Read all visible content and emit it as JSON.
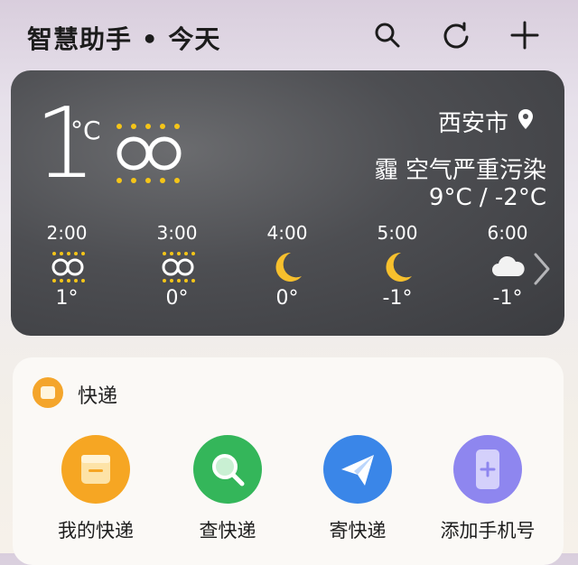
{
  "header": {
    "title": "智慧助手 • 今天",
    "icons": [
      "search-icon",
      "refresh-icon",
      "add-icon"
    ]
  },
  "weather": {
    "current_temp": "1",
    "unit": "°C",
    "condition_icon": "fog-icon",
    "city": "西安市",
    "air_quality": "霾 空气严重污染",
    "range": "9°C / -2°C",
    "hourly": [
      {
        "time": "2:00",
        "icon": "fog-icon",
        "temp": "1°"
      },
      {
        "time": "3:00",
        "icon": "fog-icon",
        "temp": "0°"
      },
      {
        "time": "4:00",
        "icon": "moon-icon",
        "temp": "0°"
      },
      {
        "time": "5:00",
        "icon": "moon-icon",
        "temp": "-1°"
      },
      {
        "time": "6:00",
        "icon": "cloud-icon",
        "temp": "-1°"
      }
    ]
  },
  "express": {
    "title": "快递",
    "actions": [
      {
        "label": "我的快递",
        "color": "#f6a623",
        "icon": "package-icon"
      },
      {
        "label": "查快递",
        "color": "#34b65a",
        "icon": "search-icon"
      },
      {
        "label": "寄快递",
        "color": "#3a86e8",
        "icon": "send-icon"
      },
      {
        "label": "添加手机号",
        "color": "#8e86ef",
        "icon": "phone-add-icon"
      }
    ]
  },
  "colors": {
    "fog_yellow": "#f5c518",
    "moon_yellow": "#f7c02d"
  }
}
